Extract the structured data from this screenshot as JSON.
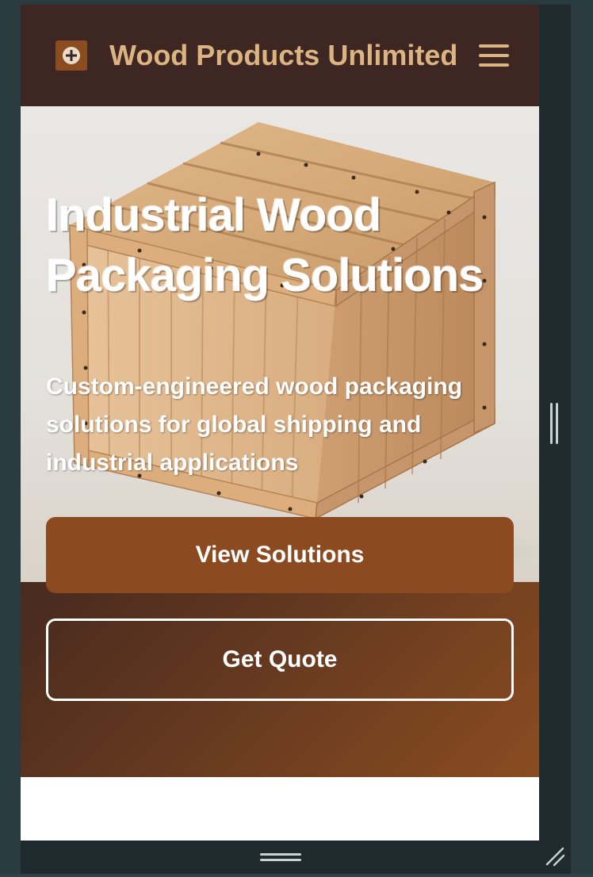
{
  "header": {
    "brand_name": "Wood Products Unlimited",
    "logo_icon": "plus-circle-icon",
    "menu_icon": "hamburger-menu-icon"
  },
  "hero": {
    "title": "Industrial Wood Packaging Solutions",
    "subtitle": "Custom-engineered wood packaging solutions for global shipping and industrial applications",
    "image_subject": "wooden crate",
    "primary_button": "View Solutions",
    "secondary_button": "Get Quote"
  },
  "colors": {
    "nav_background": "#3e2723",
    "brand_text": "#dcb482",
    "primary_button": "#8b4a1f",
    "hero_gradient_start": "#3a2420",
    "hero_gradient_end": "#8a4c20"
  }
}
